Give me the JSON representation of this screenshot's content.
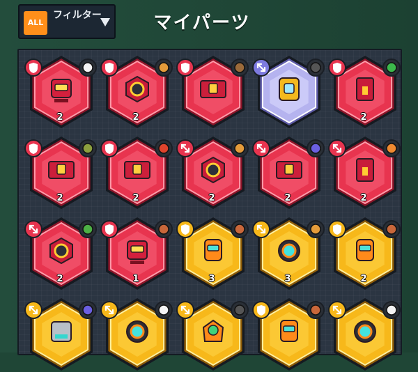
{
  "header": {
    "filter_all_label": "ALL",
    "filter_label": "フィルター",
    "title": "マイパーツ"
  },
  "colors": {
    "red_hex": "#e8344f",
    "yellow_hex": "#f7b81a",
    "holo_hex": "#b5b3ef",
    "accent_orange": "#ff8f1a"
  },
  "parts": [
    {
      "level": "2",
      "rarity": "red",
      "icon": "robot-head",
      "left_badge": "shield-red",
      "right_badge": "soccer-ball-icon"
    },
    {
      "level": "2",
      "rarity": "red",
      "icon": "spiky-core",
      "left_badge": "shield-red",
      "right_badge": "croissant-icon"
    },
    {
      "level": "",
      "rarity": "red",
      "icon": "treasure-chest",
      "left_badge": "shield-red",
      "right_badge": "pinecone-icon"
    },
    {
      "level": "",
      "rarity": "holo",
      "icon": "gold-frame",
      "left_badge": "arrows-purple",
      "right_badge": "camera-icon"
    },
    {
      "level": "2",
      "rarity": "red",
      "icon": "red-pack",
      "left_badge": "shield-red",
      "right_badge": "watermelon-icon"
    },
    {
      "level": "2",
      "rarity": "red",
      "icon": "red-cube",
      "left_badge": "shield-red",
      "right_badge": "tire-icon"
    },
    {
      "level": "2",
      "rarity": "red",
      "icon": "red-block",
      "left_badge": "shield-red",
      "right_badge": "boomerang-icon"
    },
    {
      "level": "2",
      "rarity": "red",
      "icon": "red-triad",
      "left_badge": "arrows-red",
      "right_badge": "croissant-icon"
    },
    {
      "level": "2",
      "rarity": "red",
      "icon": "red-crate",
      "left_badge": "arrows-red",
      "right_badge": "party-hat-icon"
    },
    {
      "level": "2",
      "rarity": "red",
      "icon": "red-trousers",
      "left_badge": "arrows-red",
      "right_badge": "pizza-icon"
    },
    {
      "level": "2",
      "rarity": "red",
      "icon": "red-hexa-ring",
      "left_badge": "arrows-red",
      "right_badge": "bottle-icon"
    },
    {
      "level": "1",
      "rarity": "red",
      "icon": "red-robot",
      "left_badge": "shield-red",
      "right_badge": "brick-icon"
    },
    {
      "level": "3",
      "rarity": "yellow",
      "icon": "orange-bot",
      "left_badge": "shield-yellow",
      "right_badge": "brick-icon"
    },
    {
      "level": "3",
      "rarity": "yellow",
      "icon": "cyan-eye",
      "left_badge": "arrows-yellow",
      "right_badge": "croissant-icon"
    },
    {
      "level": "2",
      "rarity": "yellow",
      "icon": "orange-bot",
      "left_badge": "shield-yellow",
      "right_badge": "brick-icon"
    },
    {
      "level": "",
      "rarity": "yellow",
      "icon": "gray-device",
      "left_badge": "arrows-yellow",
      "right_badge": "party-hat-icon"
    },
    {
      "level": "",
      "rarity": "yellow",
      "icon": "cyan-eye",
      "left_badge": "arrows-yellow",
      "right_badge": "soccer-ball-icon"
    },
    {
      "level": "",
      "rarity": "yellow",
      "icon": "green-pod",
      "left_badge": "arrows-yellow",
      "right_badge": "camera-icon"
    },
    {
      "level": "",
      "rarity": "yellow",
      "icon": "orange-bot",
      "left_badge": "shield-yellow",
      "right_badge": "brick-icon"
    },
    {
      "level": "",
      "rarity": "yellow",
      "icon": "cyan-eye",
      "left_badge": "arrows-yellow",
      "right_badge": "soccer-ball-icon"
    }
  ]
}
